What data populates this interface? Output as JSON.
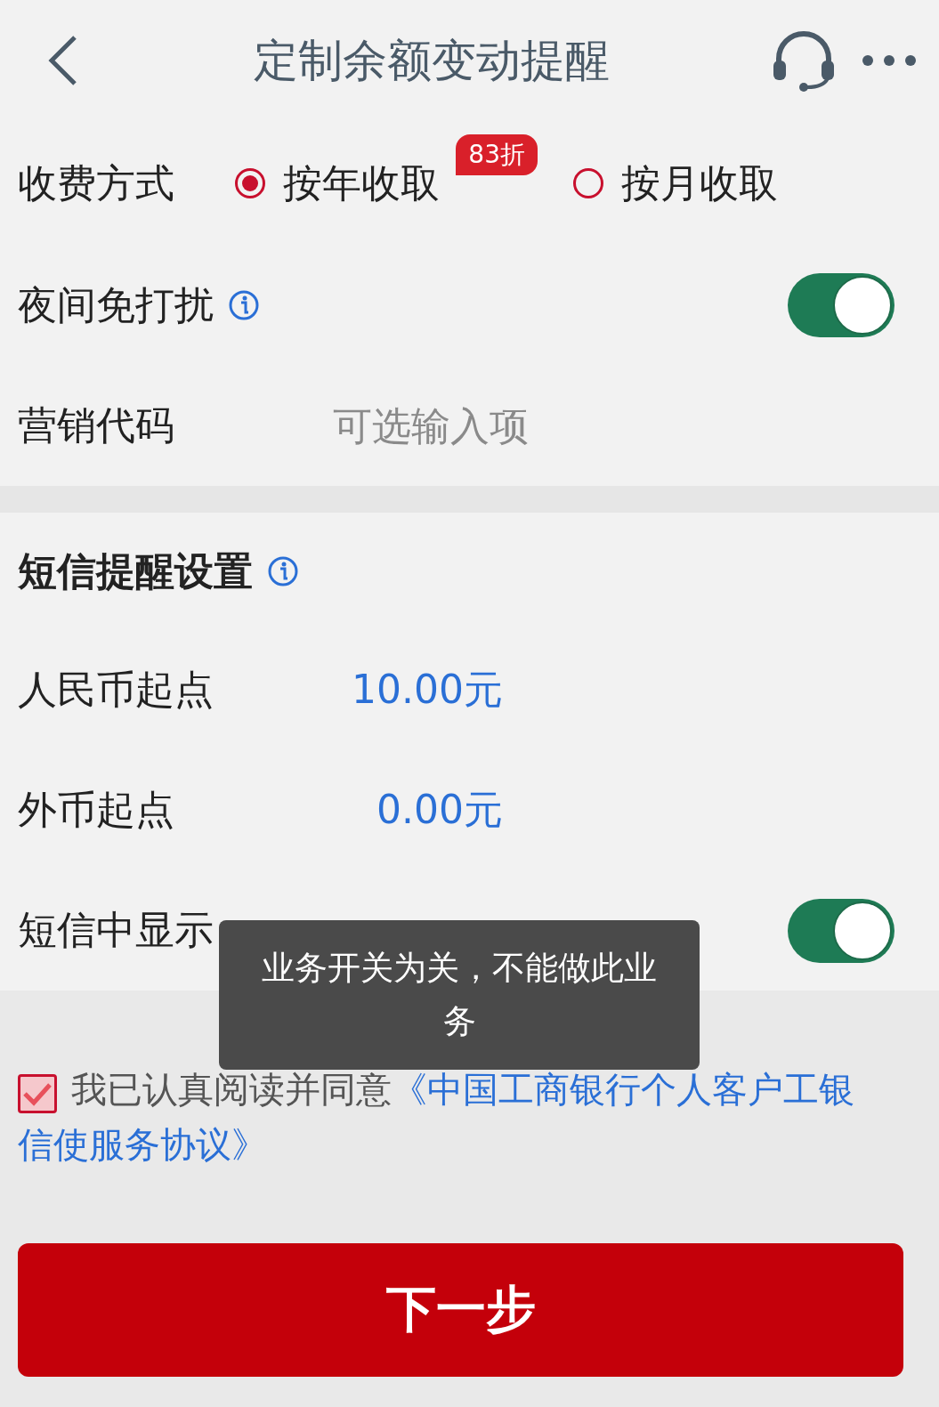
{
  "header": {
    "title": "定制余额变动提醒"
  },
  "fee": {
    "label": "收费方式",
    "options": [
      {
        "label": "按年收取",
        "selected": true,
        "badge": "83折"
      },
      {
        "label": "按月收取",
        "selected": false
      }
    ]
  },
  "night_mode": {
    "label": "夜间免打扰",
    "on": true
  },
  "marketing_code": {
    "label": "营销代码",
    "placeholder": "可选输入项"
  },
  "sms": {
    "title": "短信提醒设置",
    "rows": [
      {
        "kind": "value",
        "label": "人民币起点",
        "value": "10.00元"
      },
      {
        "kind": "value",
        "label": "外币起点",
        "value": "0.00元"
      },
      {
        "kind": "toggle",
        "label": "短信中显示",
        "on": true
      }
    ]
  },
  "agreement": {
    "checked": true,
    "text": "我已认真阅读并同意",
    "link_lines": [
      "《中国工商银行个人客户工银",
      "信使服务协议》"
    ]
  },
  "next_button": "下一步",
  "toast": "业务开关为关，不能做此业务"
}
